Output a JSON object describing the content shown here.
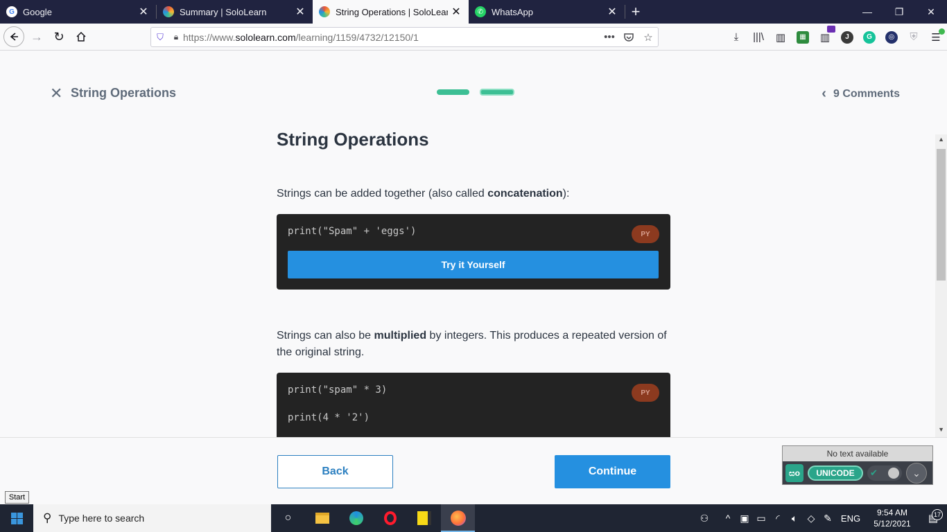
{
  "browser": {
    "tabs": [
      {
        "title": "Google",
        "icon": "google-icon",
        "icon_color": "#4285f4",
        "icon_glyph": "G",
        "active": false
      },
      {
        "title": "Summary | SoloLearn",
        "icon": "sololearn-icon",
        "icon_color": "#e8553c",
        "icon_glyph": "",
        "active": false
      },
      {
        "title": "String Operations | SoloLearn",
        "icon": "sololearn-icon",
        "icon_color": "#e8553c",
        "icon_glyph": "",
        "active": true
      },
      {
        "title": "WhatsApp",
        "icon": "whatsapp-icon",
        "icon_color": "#25d366",
        "icon_glyph": "",
        "active": false
      }
    ],
    "url_prefix": "https://www.",
    "url_domain": "sololearn.com",
    "url_path": "/learning/1159/4732/12150/1"
  },
  "lesson": {
    "header_title": "String Operations",
    "comments_label": "9 Comments",
    "heading": "String Operations",
    "para1_before": "Strings can be added together (also called ",
    "para1_bold": "concatenation",
    "para1_after": "):",
    "code1_line": "print(\"Spam\" + 'eggs')",
    "badge_label": "PY",
    "try_label": "Try it Yourself",
    "para2_before": "Strings can also be ",
    "para2_bold": "multiplied",
    "para2_after": " by integers. This produces a repeated version of the original string.",
    "code2_line1": "print(\"spam\" * 3)",
    "code2_line2": "print(4 * '2')"
  },
  "footer": {
    "back_label": "Back",
    "continue_label": "Continue"
  },
  "tooltip": {
    "start": "Start"
  },
  "unicode_widget": {
    "status": "No text available",
    "logo_glyph": "සo",
    "mode_label": "UNICODE"
  },
  "taskbar": {
    "search_placeholder": "Type here to search",
    "lang": "ENG",
    "time": "9:54 AM",
    "date": "5/12/2021",
    "notif_count": "17"
  },
  "colors": {
    "accent_blue": "#2590e0",
    "progress_green": "#3dbf94",
    "code_bg": "#232323",
    "badge_bg": "#8c3a1f"
  }
}
